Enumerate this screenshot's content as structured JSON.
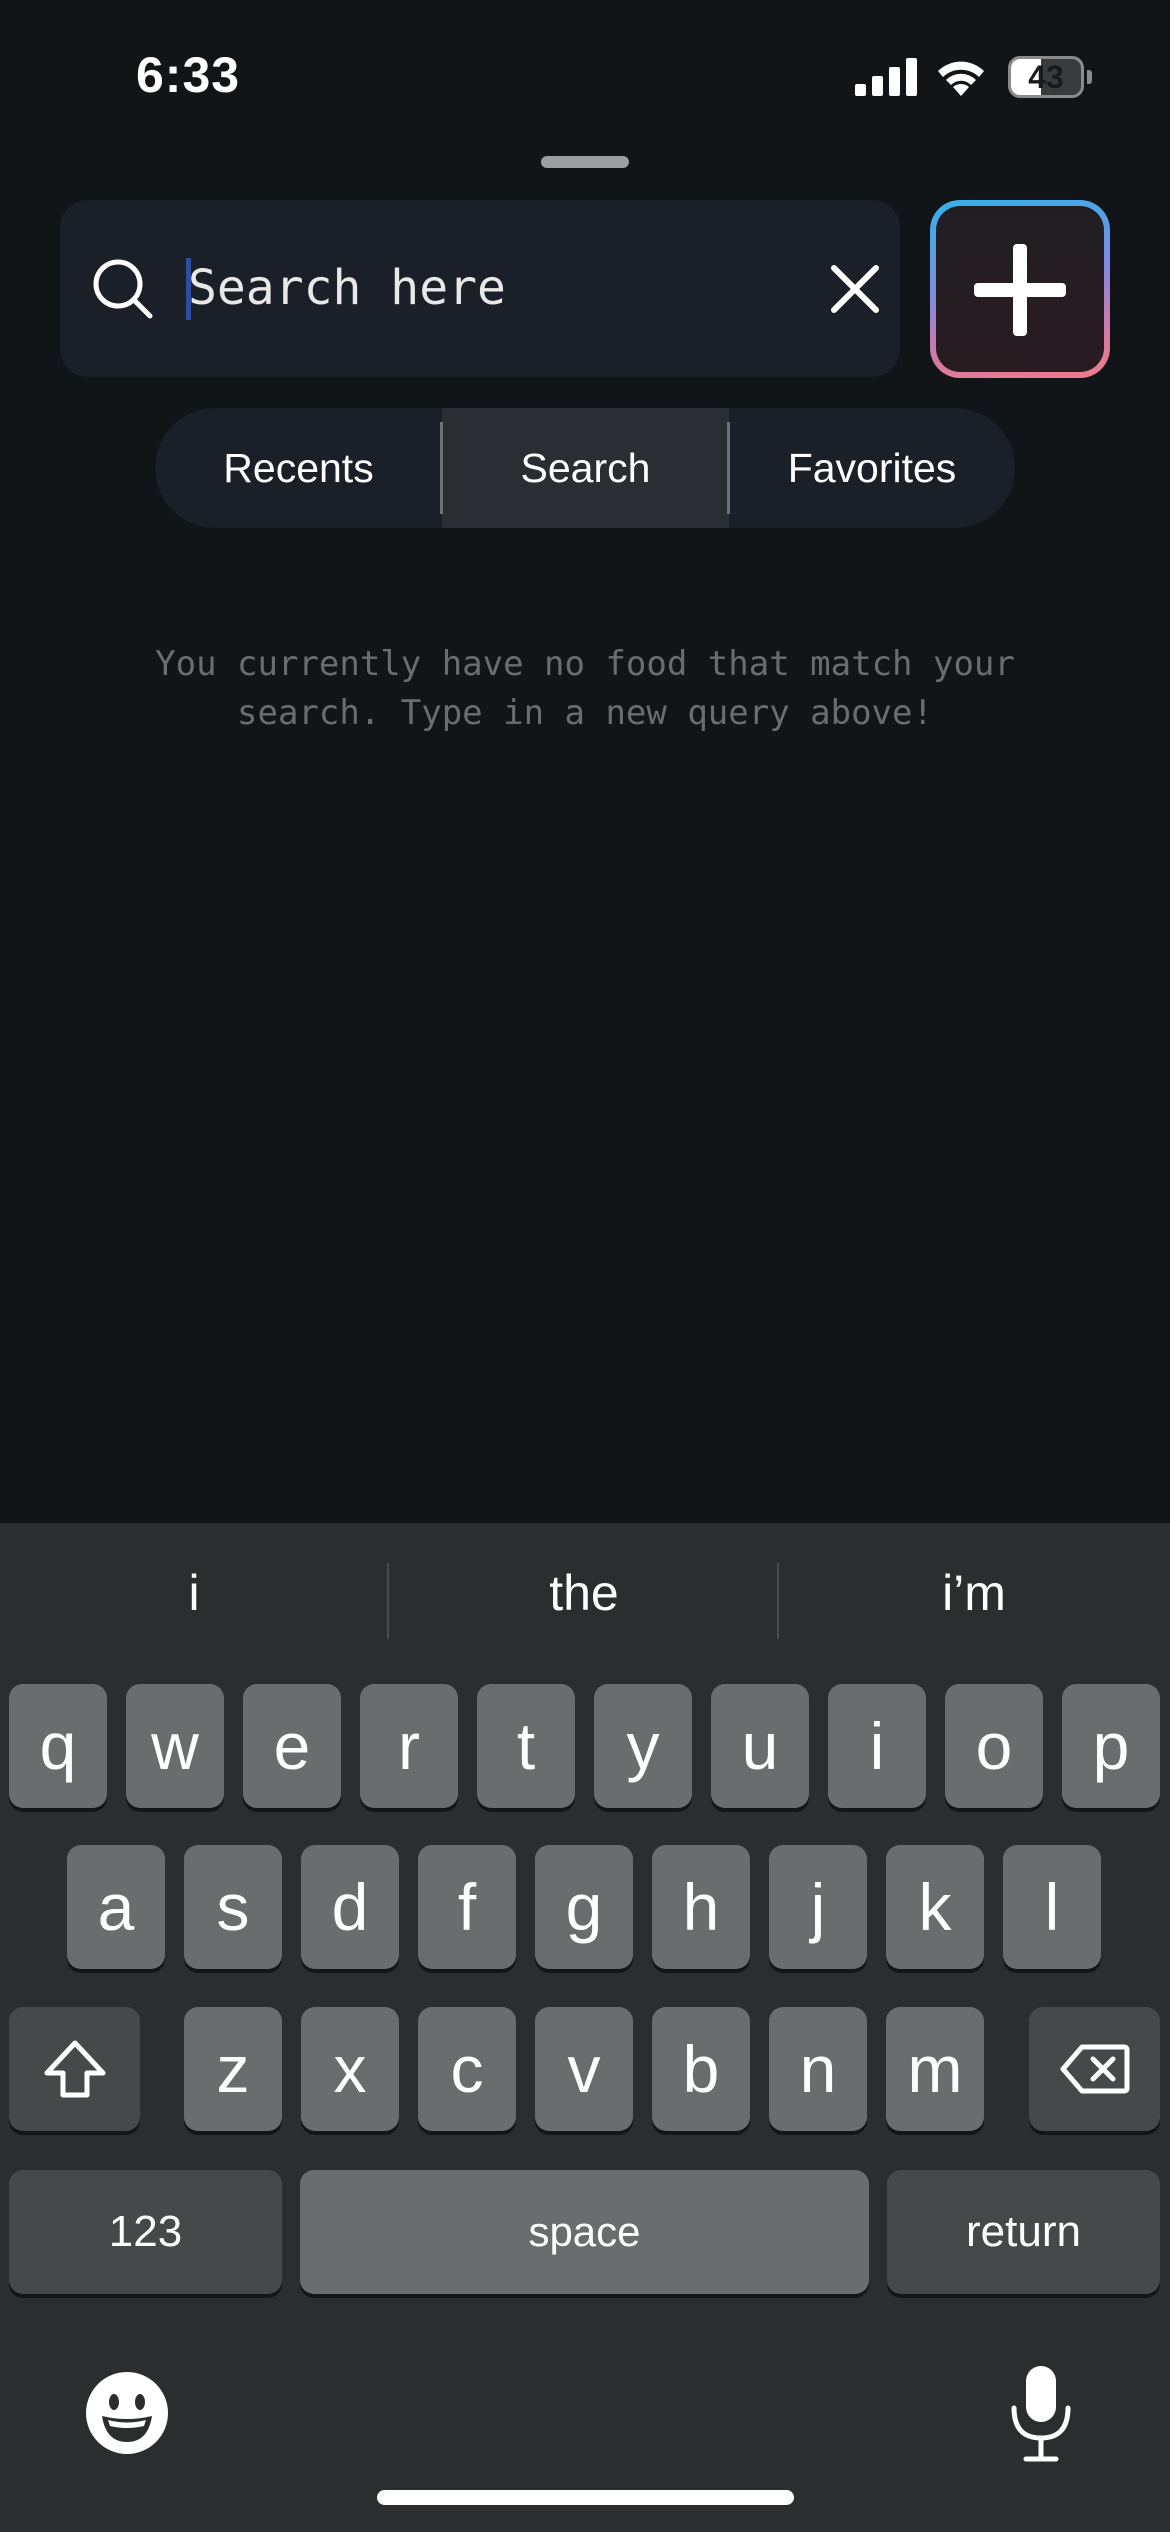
{
  "status_bar": {
    "time": "6:33",
    "battery": "43",
    "battery_level": 0.43,
    "signal_icon": "cellular-signal-icon",
    "wifi_icon": "wifi-icon"
  },
  "search": {
    "placeholder": "Search here",
    "value": "",
    "search_icon": "magnifier-icon",
    "clear_icon": "close-x-icon"
  },
  "add_button": {
    "icon": "plus-icon"
  },
  "tabs": [
    {
      "label": "Recents",
      "active": false
    },
    {
      "label": "Search",
      "active": true
    },
    {
      "label": "Favorites",
      "active": false
    }
  ],
  "empty_message": "You currently have no food that match your\nsearch. Type in a new query above!",
  "keyboard": {
    "suggestions": [
      "i",
      "the",
      "i’m"
    ],
    "row1": [
      "q",
      "w",
      "e",
      "r",
      "t",
      "y",
      "u",
      "i",
      "o",
      "p"
    ],
    "row2": [
      "a",
      "s",
      "d",
      "f",
      "g",
      "h",
      "j",
      "k",
      "l"
    ],
    "row3": [
      "z",
      "x",
      "c",
      "v",
      "b",
      "n",
      "m"
    ],
    "numbers_label": "123",
    "space_label": "space",
    "return_label": "return",
    "shift_icon": "shift-arrow-icon",
    "delete_icon": "backspace-icon",
    "emoji_icon": "emoji-face-icon",
    "mic_icon": "microphone-icon"
  },
  "colors": {
    "background": "#121517",
    "field": "#1b1f27",
    "active_tab": "#2a2d31",
    "accent_gradient": [
      "#33b2e9",
      "#f27a87"
    ],
    "muted_text": "#6a6d70"
  }
}
